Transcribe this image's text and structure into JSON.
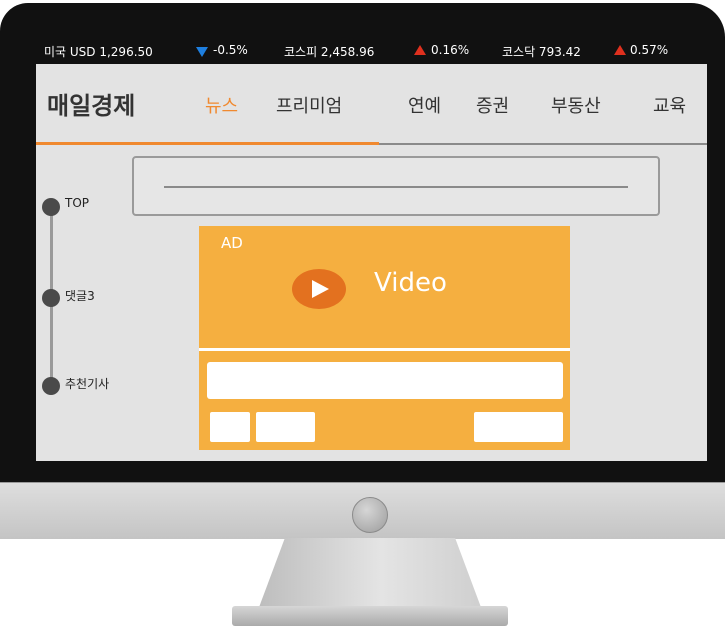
{
  "ticker": {
    "usd": "미국 USD 1,296.50",
    "usd_change": "-0.5%",
    "kospi": "코스피 2,458.96",
    "kospi_change": "0.16%",
    "kosdaq": "코스닥 793.42",
    "kosdaq_change": "0.57%"
  },
  "logo": "매일경제",
  "nav": {
    "items": [
      "뉴스",
      "프리미엄",
      "연예",
      "증권",
      "부동산",
      "교육"
    ],
    "active": "뉴스"
  },
  "side_rail": {
    "items": [
      "TOP",
      "댓글3",
      "추천기사"
    ]
  },
  "ad": {
    "label": "AD",
    "video": "Video"
  },
  "colors": {
    "accent": "#f0892f",
    "ad_background": "#f5af40",
    "play_button": "#e3711f",
    "down": "#1e7fe0",
    "up": "#e0301e"
  }
}
